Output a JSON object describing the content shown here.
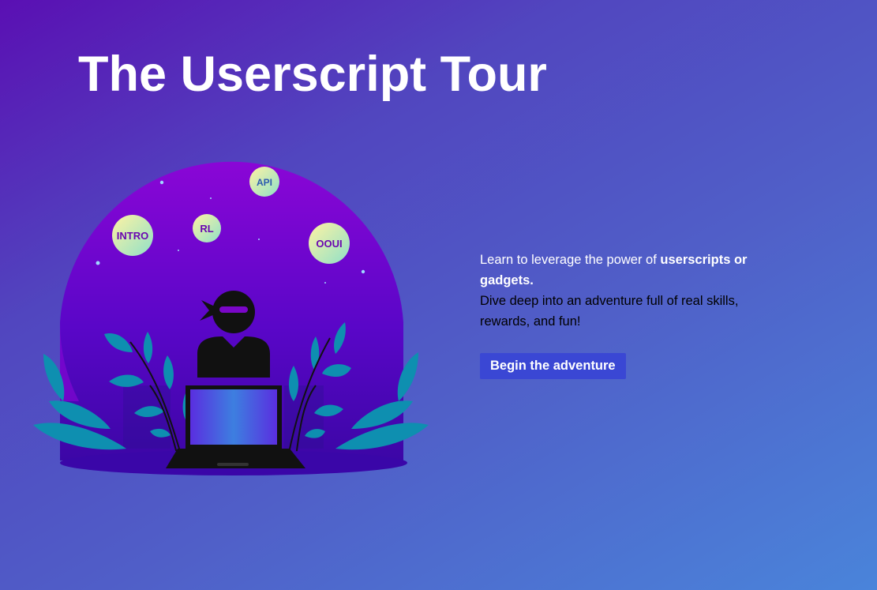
{
  "page": {
    "title": "The Userscript Tour"
  },
  "intro": {
    "line1_prefix": "Learn to leverage the power of ",
    "line1_bold": "userscripts or gadgets.",
    "line2": "Dive deep into an adventure full of real skills, rewards, and fun!"
  },
  "cta": {
    "label": "Begin the adventure"
  },
  "illustration": {
    "badges": {
      "intro": "INTRO",
      "rl": "RL",
      "api": "API",
      "ooui": "OOUI"
    }
  },
  "colors": {
    "background_start": "#5a0fb3",
    "background_end": "#4a84da",
    "button": "#3a47d4",
    "globe": "#6a06d0",
    "leaves": "#0e8fb0"
  }
}
